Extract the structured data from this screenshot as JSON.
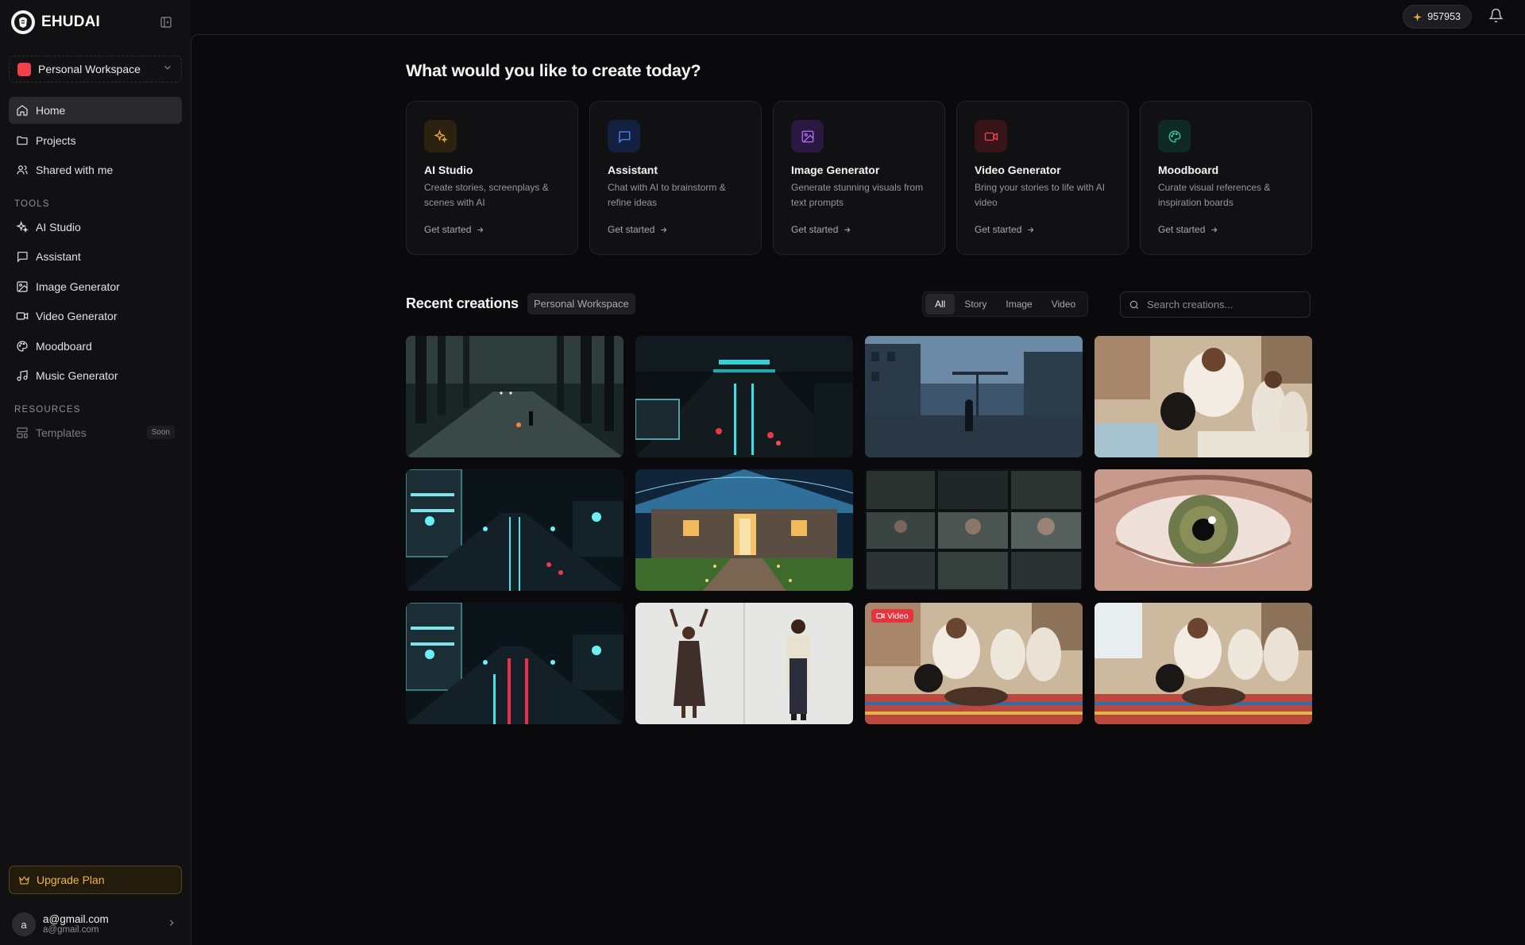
{
  "app": {
    "name": "EHUDAI"
  },
  "sidebar": {
    "workspace": "Personal Workspace",
    "nav": [
      {
        "label": "Home",
        "icon": "home-icon",
        "active": true
      },
      {
        "label": "Projects",
        "icon": "folder-icon"
      },
      {
        "label": "Shared with me",
        "icon": "users-icon"
      }
    ],
    "tools_header": "TOOLS",
    "tools": [
      {
        "label": "AI Studio",
        "icon": "sparkles-icon"
      },
      {
        "label": "Assistant",
        "icon": "message-square-icon"
      },
      {
        "label": "Image Generator",
        "icon": "image-icon"
      },
      {
        "label": "Video Generator",
        "icon": "video-icon"
      },
      {
        "label": "Moodboard",
        "icon": "palette-icon"
      },
      {
        "label": "Music Generator",
        "icon": "music-icon"
      }
    ],
    "resources_header": "RESOURCES",
    "resources": [
      {
        "label": "Templates",
        "icon": "layout-template-icon",
        "badge": "Soon",
        "disabled": true
      }
    ],
    "upgrade_label": "Upgrade Plan",
    "user": {
      "avatar_initial": "a",
      "name": "a@gmail.com",
      "email": "a@gmail.com"
    }
  },
  "topbar": {
    "credits": "957953"
  },
  "main": {
    "headline": "What would you like to create today?",
    "cards": [
      {
        "title": "AI Studio",
        "desc": "Create stories, screenplays & scenes with AI",
        "cta": "Get started",
        "icon": "sparkles-icon",
        "color": "#f0a53a",
        "bg": "#2b2210"
      },
      {
        "title": "Assistant",
        "desc": "Chat with AI to brainstorm & refine ideas",
        "cta": "Get started",
        "icon": "message-square-icon",
        "color": "#4f8ef7",
        "bg": "#142040"
      },
      {
        "title": "Image Generator",
        "desc": "Generate stunning visuals from text prompts",
        "cta": "Get started",
        "icon": "image-icon",
        "color": "#b56cf5",
        "bg": "#2a1840"
      },
      {
        "title": "Video Generator",
        "desc": "Bring your stories to life with AI video",
        "cta": "Get started",
        "icon": "video-icon",
        "color": "#ef4a4f",
        "bg": "#361418"
      },
      {
        "title": "Moodboard",
        "desc": "Curate visual references & inspiration boards",
        "cta": "Get started",
        "icon": "palette-icon",
        "color": "#2dcfa1",
        "bg": "#0f2a22"
      }
    ],
    "recent": {
      "title": "Recent creations",
      "workspace_chip": "Personal Workspace",
      "filters": [
        "All",
        "Story",
        "Image",
        "Video"
      ],
      "active_filter": "All",
      "search_placeholder": "Search creations...",
      "video_badge": "Video",
      "items": [
        {
          "scene": "dark-forest-road-icon"
        },
        {
          "scene": "neon-street-night-icon"
        },
        {
          "scene": "ruined-city-figure-icon"
        },
        {
          "scene": "coffee-ceremony-icon"
        },
        {
          "scene": "city-boulevard-lights-icon"
        },
        {
          "scene": "lit-house-night-icon"
        },
        {
          "scene": "storyboard-collage-icon"
        },
        {
          "scene": "eye-closeup-icon"
        },
        {
          "scene": "city-boulevard-red-lights-icon"
        },
        {
          "scene": "two-people-studio-icon"
        },
        {
          "scene": "coffee-ceremony-video-icon",
          "video": true
        },
        {
          "scene": "coffee-ceremony-icon"
        }
      ]
    }
  }
}
